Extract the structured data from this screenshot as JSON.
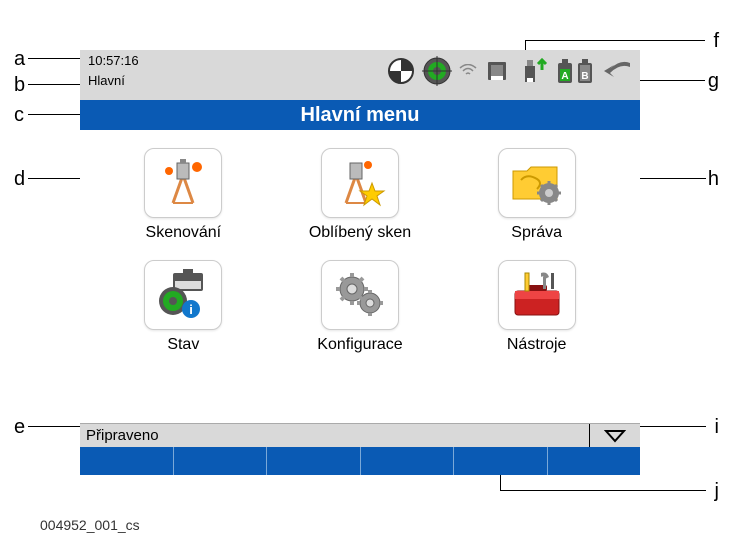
{
  "header": {
    "time": "10:57:16",
    "breadcrumb": "Hlavní"
  },
  "title": "Hlavní menu",
  "menu": [
    {
      "label": "Skenování",
      "icon": "survey-scan"
    },
    {
      "label": "Oblíbený sken",
      "icon": "survey-star"
    },
    {
      "label": "Správa",
      "icon": "folder-gear"
    },
    {
      "label": "Stav",
      "icon": "status-info"
    },
    {
      "label": "Konfigurace",
      "icon": "gears"
    },
    {
      "label": "Nástroje",
      "icon": "toolbox"
    }
  ],
  "status": "Připraveno",
  "doc_id": "004952_001_cs",
  "callouts": {
    "a": "a",
    "b": "b",
    "c": "c",
    "d": "d",
    "e": "e",
    "f": "f",
    "g": "g",
    "h": "h",
    "i": "i",
    "j": "j"
  }
}
